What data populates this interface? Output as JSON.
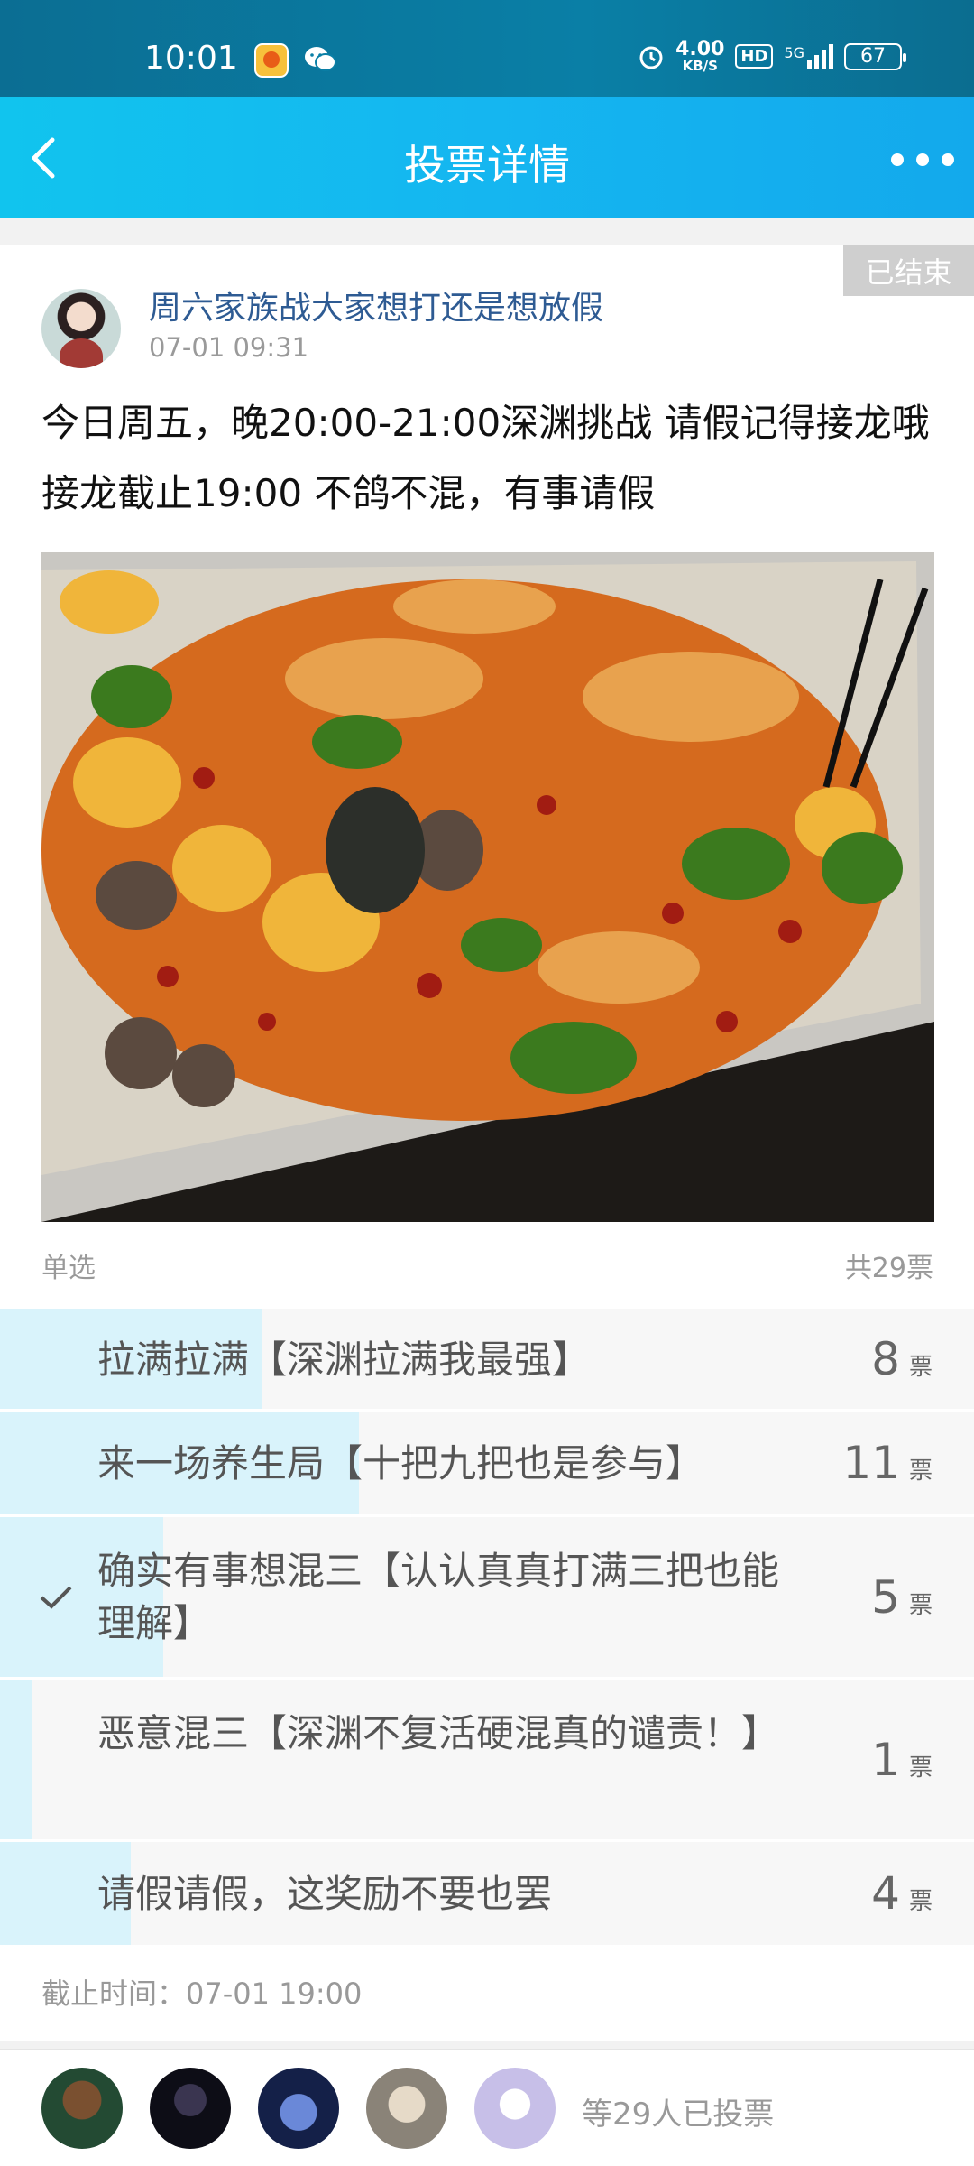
{
  "status_bar": {
    "time": "10:01",
    "net_speed": "4.00",
    "net_unit": "KB/S",
    "hd": "HD",
    "signal": "5G",
    "battery": "67"
  },
  "nav": {
    "title": "投票详情"
  },
  "post": {
    "badge": "已结束",
    "title": "周六家族战大家想打还是想放假",
    "time": "07-01 09:31",
    "body": "今日周五，晚20:00-21:00深渊挑战 请假记得接龙哦 接龙截止19:00 不鸽不混，有事请假"
  },
  "vote": {
    "type": "单选",
    "total": "共29票",
    "unit": "票",
    "options": [
      {
        "label": "拉满拉满【深渊拉满我最强】",
        "count": "8",
        "fraction": 0.276,
        "selected": false
      },
      {
        "label": "来一场养生局【十把九把也是参与】",
        "count": "11",
        "fraction": 0.379,
        "selected": false
      },
      {
        "label": "确实有事想混三【认认真真打满三把也能理解】",
        "count": "5",
        "fraction": 0.172,
        "selected": true
      },
      {
        "label": "恶意混三【深渊不复活硬混真的谴责！】",
        "count": "1",
        "fraction": 0.034,
        "selected": false
      },
      {
        "label": "请假请假，这奖励不要也罢",
        "count": "4",
        "fraction": 0.138,
        "selected": false
      }
    ],
    "deadline": "截止时间：07-01 19:00"
  },
  "footer": {
    "voter_count": "等29人已投票"
  },
  "colors": {
    "accent": "#15b6f0",
    "fill": "#d9f3fb",
    "title_link": "#2e5b93"
  }
}
